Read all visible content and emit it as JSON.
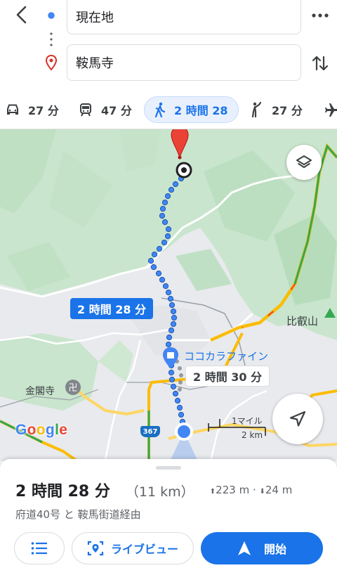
{
  "search": {
    "origin_value": "現在地",
    "destination_value": "鞍馬寺"
  },
  "modes": [
    {
      "icon": "car-icon",
      "label": "27 分"
    },
    {
      "icon": "train-icon",
      "label": "47 分"
    },
    {
      "icon": "walk-icon",
      "label": "2 時間 28",
      "active": true
    },
    {
      "icon": "hail-icon",
      "label": "27 分"
    },
    {
      "icon": "plane-icon",
      "label": ""
    }
  ],
  "map": {
    "primary_time": "2 時間 28 分",
    "alt_time": "2 時間 30 分",
    "poi_cocokara": "ココカラファイン",
    "poi_kinkakuji": "金閣寺",
    "poi_hieizan": "比叡山",
    "route_shield": "367",
    "scale_miles": "1マイル",
    "scale_km": "2 km",
    "google_logo": "Google"
  },
  "summary": {
    "duration": "2 時間 28 分",
    "distance": "（11 km）",
    "elevation": "223 m · 24 m",
    "via": "府道40号 と 鞍馬街道経由"
  },
  "actions": {
    "live_view_label": "ライブビュー",
    "start_label": "開始"
  },
  "colors": {
    "accent": "#1a73e8",
    "destination_pin": "#d93025",
    "map_green": "#c9e5cd",
    "map_urban": "#e8eaed"
  }
}
